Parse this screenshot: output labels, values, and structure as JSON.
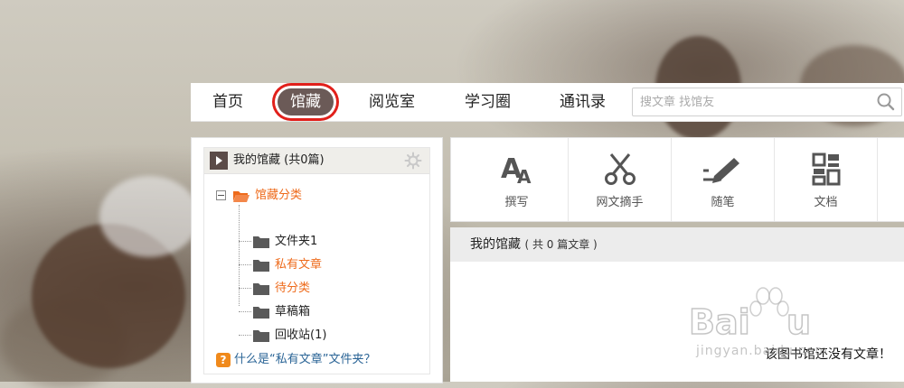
{
  "nav": {
    "items": [
      {
        "label": "首页",
        "active": false
      },
      {
        "label": "馆藏",
        "active": true
      },
      {
        "label": "阅览室",
        "active": false
      },
      {
        "label": "学习圈",
        "active": false
      },
      {
        "label": "通讯录",
        "active": false
      }
    ],
    "search_placeholder": "搜文章 找馆友"
  },
  "left_panel": {
    "title": "我的馆藏 (共0篇)",
    "tree_root": "馆藏分类",
    "folders": [
      {
        "label": "文件夹1",
        "highlight": false
      },
      {
        "label": "私有文章",
        "highlight": true
      },
      {
        "label": "待分类",
        "highlight": true
      },
      {
        "label": "草稿箱",
        "highlight": false
      },
      {
        "label": "回收站(1)",
        "highlight": false
      }
    ],
    "help_text": "什么是“私有文章”文件夹？"
  },
  "toolbar": {
    "items": [
      {
        "label": "撰写",
        "icon": "write-icon"
      },
      {
        "label": "网文摘手",
        "icon": "scissors-icon"
      },
      {
        "label": "随笔",
        "icon": "pen-icon"
      },
      {
        "label": "文档",
        "icon": "document-icon"
      }
    ]
  },
  "collection": {
    "title": "我的馆藏",
    "count": "( 共 0 篇文章 )",
    "empty_message": "该图书馆还没有文章！"
  },
  "watermark": {
    "text": "jingyan.baidu.com",
    "brand": "Baidu经验"
  },
  "colors": {
    "accent_orange": "#ee6b1c",
    "active_tab": "#6b5a57",
    "highlight_ring": "#e1201b",
    "link_blue": "#2a6496"
  }
}
